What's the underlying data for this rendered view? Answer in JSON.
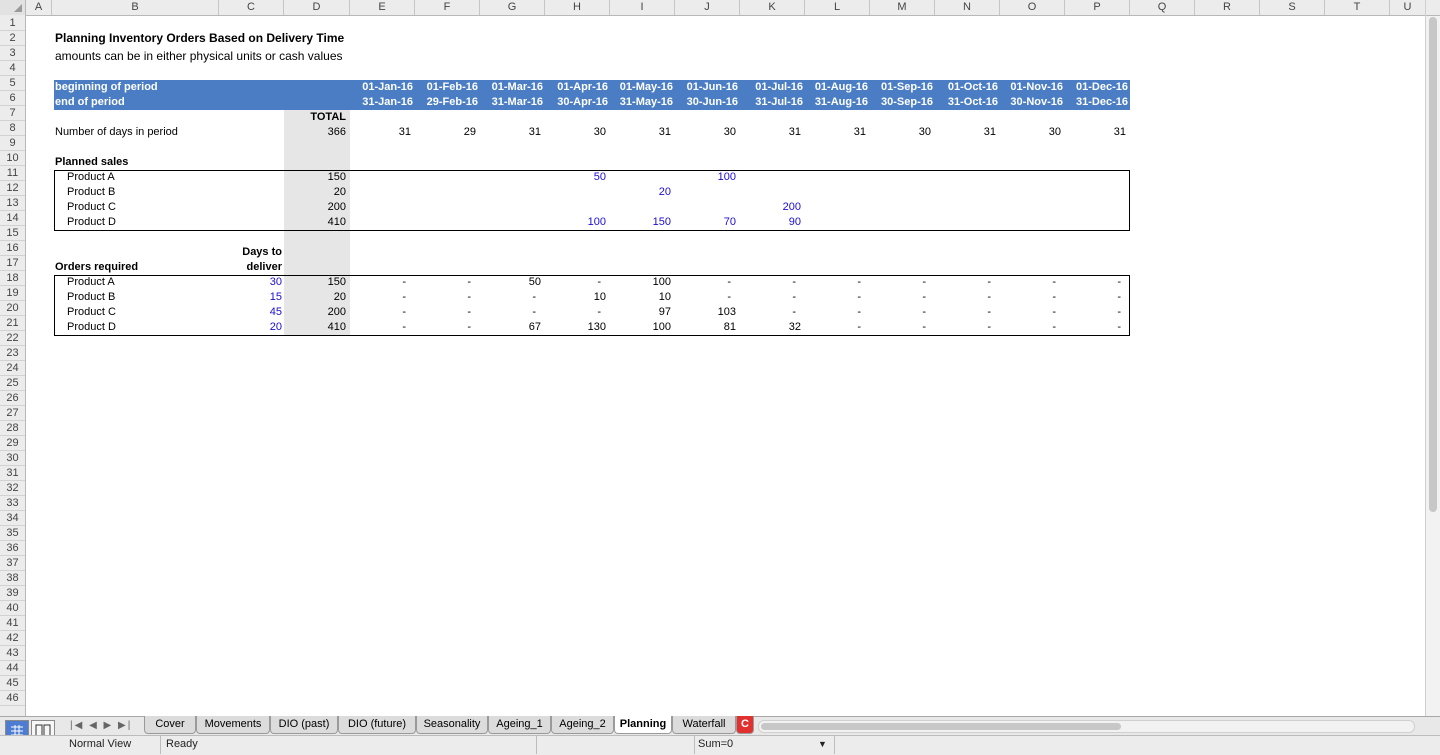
{
  "columns": [
    "A",
    "B",
    "C",
    "D",
    "E",
    "F",
    "G",
    "H",
    "I",
    "J",
    "K",
    "L",
    "M",
    "N",
    "O",
    "P",
    "Q",
    "R",
    "S",
    "T",
    "U"
  ],
  "rows": [
    "1",
    "2",
    "3",
    "4",
    "5",
    "6",
    "7",
    "8",
    "9",
    "10",
    "11",
    "12",
    "13",
    "14",
    "15",
    "16",
    "17",
    "18",
    "19",
    "20",
    "21",
    "22",
    "23",
    "24",
    "25",
    "26",
    "27",
    "28",
    "29",
    "30",
    "31",
    "32",
    "33",
    "34",
    "35",
    "36",
    "37",
    "38",
    "39",
    "40",
    "41",
    "42",
    "43",
    "44",
    "45",
    "46"
  ],
  "sheet": {
    "title": "Planning Inventory Orders Based on Delivery Time",
    "subtitle": "amounts can be in either physical units or cash values",
    "begin_label": "beginning of period",
    "end_label": "end of period",
    "period_begins": [
      "01-Jan-16",
      "01-Feb-16",
      "01-Mar-16",
      "01-Apr-16",
      "01-May-16",
      "01-Jun-16",
      "01-Jul-16",
      "01-Aug-16",
      "01-Sep-16",
      "01-Oct-16",
      "01-Nov-16",
      "01-Dec-16"
    ],
    "period_ends": [
      "31-Jan-16",
      "29-Feb-16",
      "31-Mar-16",
      "30-Apr-16",
      "31-May-16",
      "30-Jun-16",
      "31-Jul-16",
      "31-Aug-16",
      "30-Sep-16",
      "31-Oct-16",
      "30-Nov-16",
      "31-Dec-16"
    ],
    "total_label": "TOTAL",
    "days_label": "Number of days in period",
    "days_total": "366",
    "days": [
      "31",
      "29",
      "31",
      "30",
      "31",
      "30",
      "31",
      "31",
      "30",
      "31",
      "30",
      "31"
    ],
    "planned_sales_label": "Planned sales",
    "planned_sales": [
      {
        "product": "Product A",
        "total": "150",
        "values": [
          "",
          "",
          "",
          "50",
          "",
          "100",
          "",
          "",
          "",
          "",
          "",
          ""
        ]
      },
      {
        "product": "Product B",
        "total": "20",
        "values": [
          "",
          "",
          "",
          "",
          "20",
          "",
          "",
          "",
          "",
          "",
          "",
          ""
        ]
      },
      {
        "product": "Product C",
        "total": "200",
        "values": [
          "",
          "",
          "",
          "",
          "",
          "",
          "200",
          "",
          "",
          "",
          "",
          ""
        ]
      },
      {
        "product": "Product D",
        "total": "410",
        "values": [
          "",
          "",
          "",
          "100",
          "150",
          "70",
          "90",
          "",
          "",
          "",
          "",
          ""
        ]
      }
    ],
    "days_to_label_1": "Days to",
    "days_to_label_2": "deliver",
    "orders_label": "Orders required",
    "orders": [
      {
        "product": "Product A",
        "days": "30",
        "total": "150",
        "values": [
          "-",
          "-",
          "50",
          "-",
          "100",
          "-",
          "-",
          "-",
          "-",
          "-",
          "-",
          "-"
        ]
      },
      {
        "product": "Product B",
        "days": "15",
        "total": "20",
        "values": [
          "-",
          "-",
          "-",
          "10",
          "10",
          "-",
          "-",
          "-",
          "-",
          "-",
          "-",
          "-"
        ]
      },
      {
        "product": "Product C",
        "days": "45",
        "total": "200",
        "values": [
          "-",
          "-",
          "-",
          "-",
          "97",
          "103",
          "-",
          "-",
          "-",
          "-",
          "-",
          "-"
        ]
      },
      {
        "product": "Product D",
        "days": "20",
        "total": "410",
        "values": [
          "-",
          "-",
          "67",
          "130",
          "100",
          "81",
          "32",
          "-",
          "-",
          "-",
          "-",
          "-"
        ]
      }
    ]
  },
  "tabs": [
    "Cover",
    "Movements",
    "DIO (past)",
    "DIO (future)",
    "Seasonality",
    "Ageing_1",
    "Ageing_2",
    "Planning",
    "Waterfall",
    "C"
  ],
  "active_tab": "Planning",
  "status": {
    "view": "Normal View",
    "state": "Ready",
    "sum": "Sum=0"
  },
  "colors": {
    "header_band": "#4a7dc4",
    "input_blue": "#1a0dd6",
    "total_column": "#e6e6e6"
  }
}
